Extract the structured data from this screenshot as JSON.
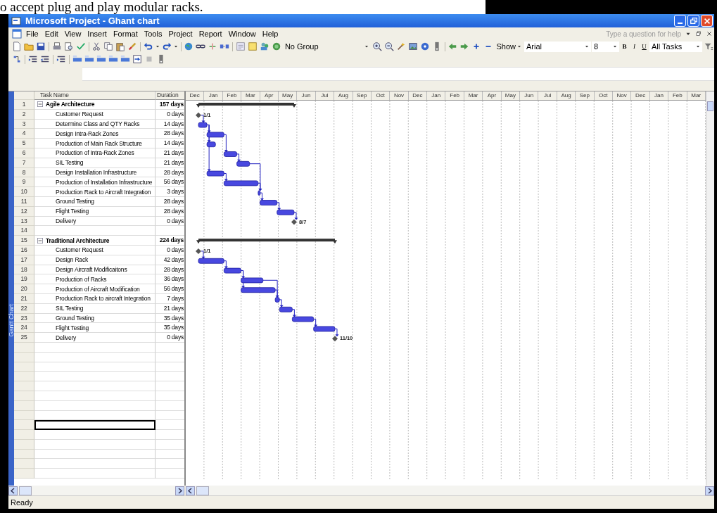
{
  "caption": "o accept plug and play modular racks.",
  "window": {
    "title": "Microsoft Project - Ghant chart"
  },
  "menu": [
    "File",
    "Edit",
    "View",
    "Insert",
    "Format",
    "Tools",
    "Project",
    "Report",
    "Window",
    "Help"
  ],
  "help_field": {
    "placeholder": "Type a question for help"
  },
  "toolbar": {
    "group": "No Group",
    "show": "Show",
    "font": "Arial",
    "size": "8",
    "format_buttons": [
      {
        "label": "B",
        "kind": "bold"
      },
      {
        "label": "I",
        "kind": "italic"
      },
      {
        "label": "U",
        "kind": "underline"
      }
    ],
    "filter": "All Tasks"
  },
  "side_label": "Gantt Chart",
  "columns": [
    "Task Name",
    "Duration"
  ],
  "months": [
    "Dec",
    "Jan",
    "Feb",
    "Mar",
    "Apr",
    "May",
    "Jun",
    "Jul",
    "Aug",
    "Sep",
    "Oct",
    "Nov",
    "Dec",
    "Jan",
    "Feb",
    "Mar",
    "Apr",
    "May",
    "Jun",
    "Jul",
    "Aug",
    "Sep",
    "Oct",
    "Nov",
    "Dec",
    "Jan",
    "Feb",
    "Mar"
  ],
  "rows": [
    {
      "id": "1",
      "name": "Agile Architecture",
      "duration": "157 days",
      "kind": "summary",
      "expanded": true,
      "children": [
        {
          "id": "2",
          "name": "Customer Request",
          "duration": "0 days",
          "kind": "milestone",
          "label": "1/1"
        },
        {
          "id": "3",
          "name": "Determine Class and QTY Racks",
          "duration": "14 days",
          "kind": "task"
        },
        {
          "id": "4",
          "name": "Design Intra-Rack Zones",
          "duration": "28 days",
          "kind": "task"
        },
        {
          "id": "5",
          "name": "Production of Main Rack Structure",
          "duration": "14 days",
          "kind": "task"
        },
        {
          "id": "6",
          "name": "Production of Intra-Rack Zones",
          "duration": "21 days",
          "kind": "task"
        },
        {
          "id": "7",
          "name": "SIL Testing",
          "duration": "21 days",
          "kind": "task"
        },
        {
          "id": "8",
          "name": "Design Installation Infrastructure",
          "duration": "28 days",
          "kind": "task"
        },
        {
          "id": "9",
          "name": "Production of Installation Infrastructure",
          "duration": "56 days",
          "kind": "task"
        },
        {
          "id": "10",
          "name": "Production Rack to Aircraft Integration",
          "duration": "3 days",
          "kind": "task"
        },
        {
          "id": "11",
          "name": "Ground Testing",
          "duration": "28 days",
          "kind": "task"
        },
        {
          "id": "12",
          "name": "Flight Testing",
          "duration": "28 days",
          "kind": "task"
        },
        {
          "id": "13",
          "name": "Delivery",
          "duration": "0 days",
          "kind": "milestone",
          "label": "8/7"
        }
      ]
    },
    {
      "id": "14",
      "kind": "blank"
    },
    {
      "id": "15",
      "name": "Traditional Architecture",
      "duration": "224 days",
      "kind": "summary",
      "expanded": true,
      "children": [
        {
          "id": "16",
          "name": "Customer Request",
          "duration": "0 days",
          "kind": "milestone",
          "label": "1/1"
        },
        {
          "id": "17",
          "name": "Design Rack",
          "duration": "42 days",
          "kind": "task"
        },
        {
          "id": "18",
          "name": "Design Aircraft Modificaitons",
          "duration": "28 days",
          "kind": "task"
        },
        {
          "id": "19",
          "name": "Production of Racks",
          "duration": "36 days",
          "kind": "task"
        },
        {
          "id": "20",
          "name": "Production of Aircraft Modification",
          "duration": "56 days",
          "kind": "task"
        },
        {
          "id": "21",
          "name": "Production Rack to aircraft Integration",
          "duration": "7 days",
          "kind": "task"
        },
        {
          "id": "22",
          "name": "SIL Testing",
          "duration": "21 days",
          "kind": "task"
        },
        {
          "id": "23",
          "name": "Ground Testing",
          "duration": "35 days",
          "kind": "task"
        },
        {
          "id": "24",
          "name": "Flight Testing",
          "duration": "35 days",
          "kind": "task"
        },
        {
          "id": "25",
          "name": "Delivery",
          "duration": "0 days",
          "kind": "milestone",
          "label": "11/10"
        }
      ]
    }
  ],
  "blank_rows": [
    {
      "selected": false
    },
    {
      "selected": false
    },
    {
      "selected": false
    },
    {
      "selected": false
    },
    {
      "selected": false
    },
    {
      "selected": false
    },
    {
      "selected": false
    },
    {
      "selected": false
    },
    {
      "selected": true
    },
    {
      "selected": false
    },
    {
      "selected": false
    },
    {
      "selected": false
    },
    {
      "selected": false
    },
    {
      "selected": false
    }
  ],
  "status_bar": "Ready"
}
